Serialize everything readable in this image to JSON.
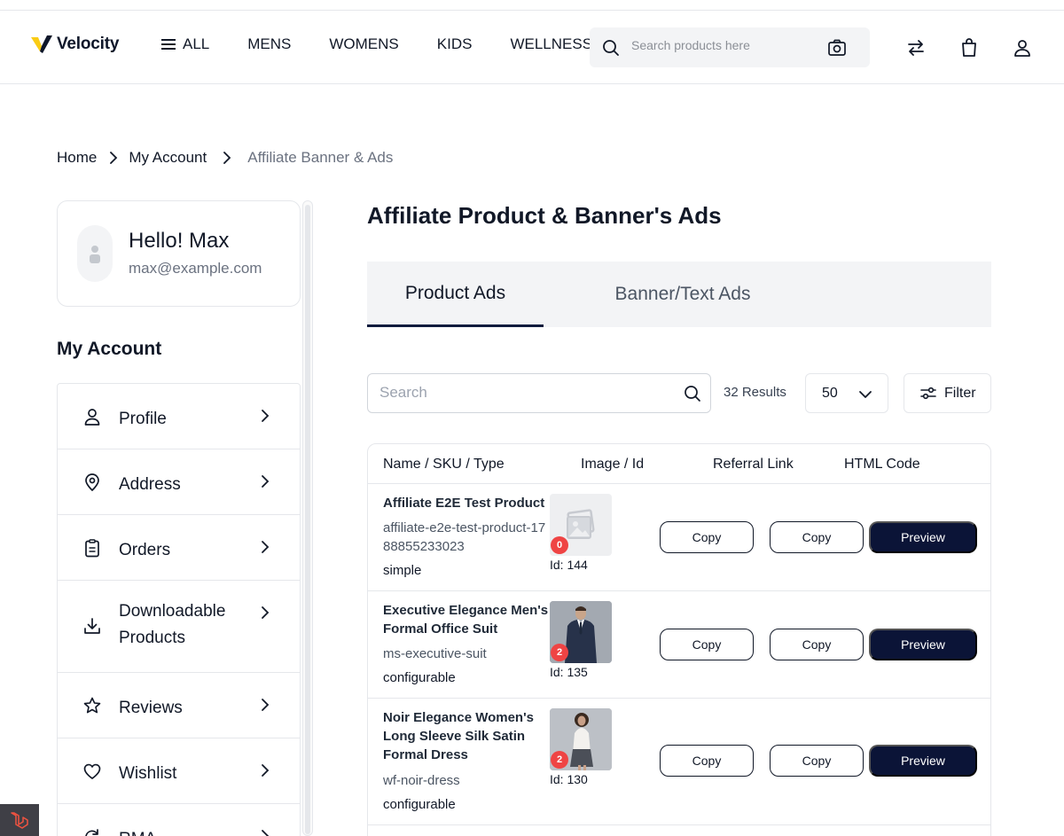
{
  "header": {
    "logo_text": "Velocity",
    "nav": [
      {
        "label": "ALL"
      },
      {
        "label": "MENS"
      },
      {
        "label": "WOMENS"
      },
      {
        "label": "KIDS"
      },
      {
        "label": "WELLNESS"
      }
    ],
    "search_placeholder": "Search products here"
  },
  "breadcrumb": {
    "home": "Home",
    "account": "My Account",
    "current": "Affiliate Banner & Ads"
  },
  "profile": {
    "greeting": "Hello! Max",
    "email": "max@example.com"
  },
  "sidebar": {
    "title": "My Account",
    "items": [
      {
        "label": "Profile",
        "icon": "user-icon"
      },
      {
        "label": "Address",
        "icon": "location-pin-icon"
      },
      {
        "label": "Orders",
        "icon": "clipboard-icon"
      },
      {
        "label": "Downloadable Products",
        "icon": "download-icon"
      },
      {
        "label": "Reviews",
        "icon": "star-icon"
      },
      {
        "label": "Wishlist",
        "icon": "heart-icon"
      },
      {
        "label": "RMA",
        "icon": "return-icon"
      }
    ]
  },
  "main": {
    "title": "Affiliate Product & Banner's Ads",
    "tabs": [
      {
        "label": "Product Ads",
        "active": true
      },
      {
        "label": "Banner/Text Ads",
        "active": false
      }
    ],
    "search_placeholder": "Search",
    "results": "32 Results",
    "per_page": "50",
    "filter_label": "Filter",
    "columns": [
      "Name / SKU / Type",
      "Image / Id",
      "Referral Link",
      "HTML Code"
    ],
    "rows": [
      {
        "name": "Affiliate E2E Test Product",
        "sku": "affiliate-e2e-test-product-1788855233023",
        "type": "simple",
        "image_count": "0",
        "id": "Id: 144",
        "referral_label": "Copy",
        "html_label": "Copy",
        "preview_label": "Preview"
      },
      {
        "name": "Executive Elegance Men's Formal Office Suit",
        "sku": "ms-executive-suit",
        "type": "configurable",
        "image_count": "2",
        "id": "Id: 135",
        "referral_label": "Copy",
        "html_label": "Copy",
        "preview_label": "Preview"
      },
      {
        "name": "Noir Elegance Women's Long Sleeve Silk Satin Formal Dress",
        "sku": "wf-noir-dress",
        "type": "configurable",
        "image_count": "2",
        "id": "Id: 130",
        "referral_label": "Copy",
        "html_label": "Copy",
        "preview_label": "Preview"
      }
    ]
  },
  "colors": {
    "primary_dark": "#0b1437",
    "badge_red": "#ef4444",
    "logo_yellow": "#facc15"
  }
}
